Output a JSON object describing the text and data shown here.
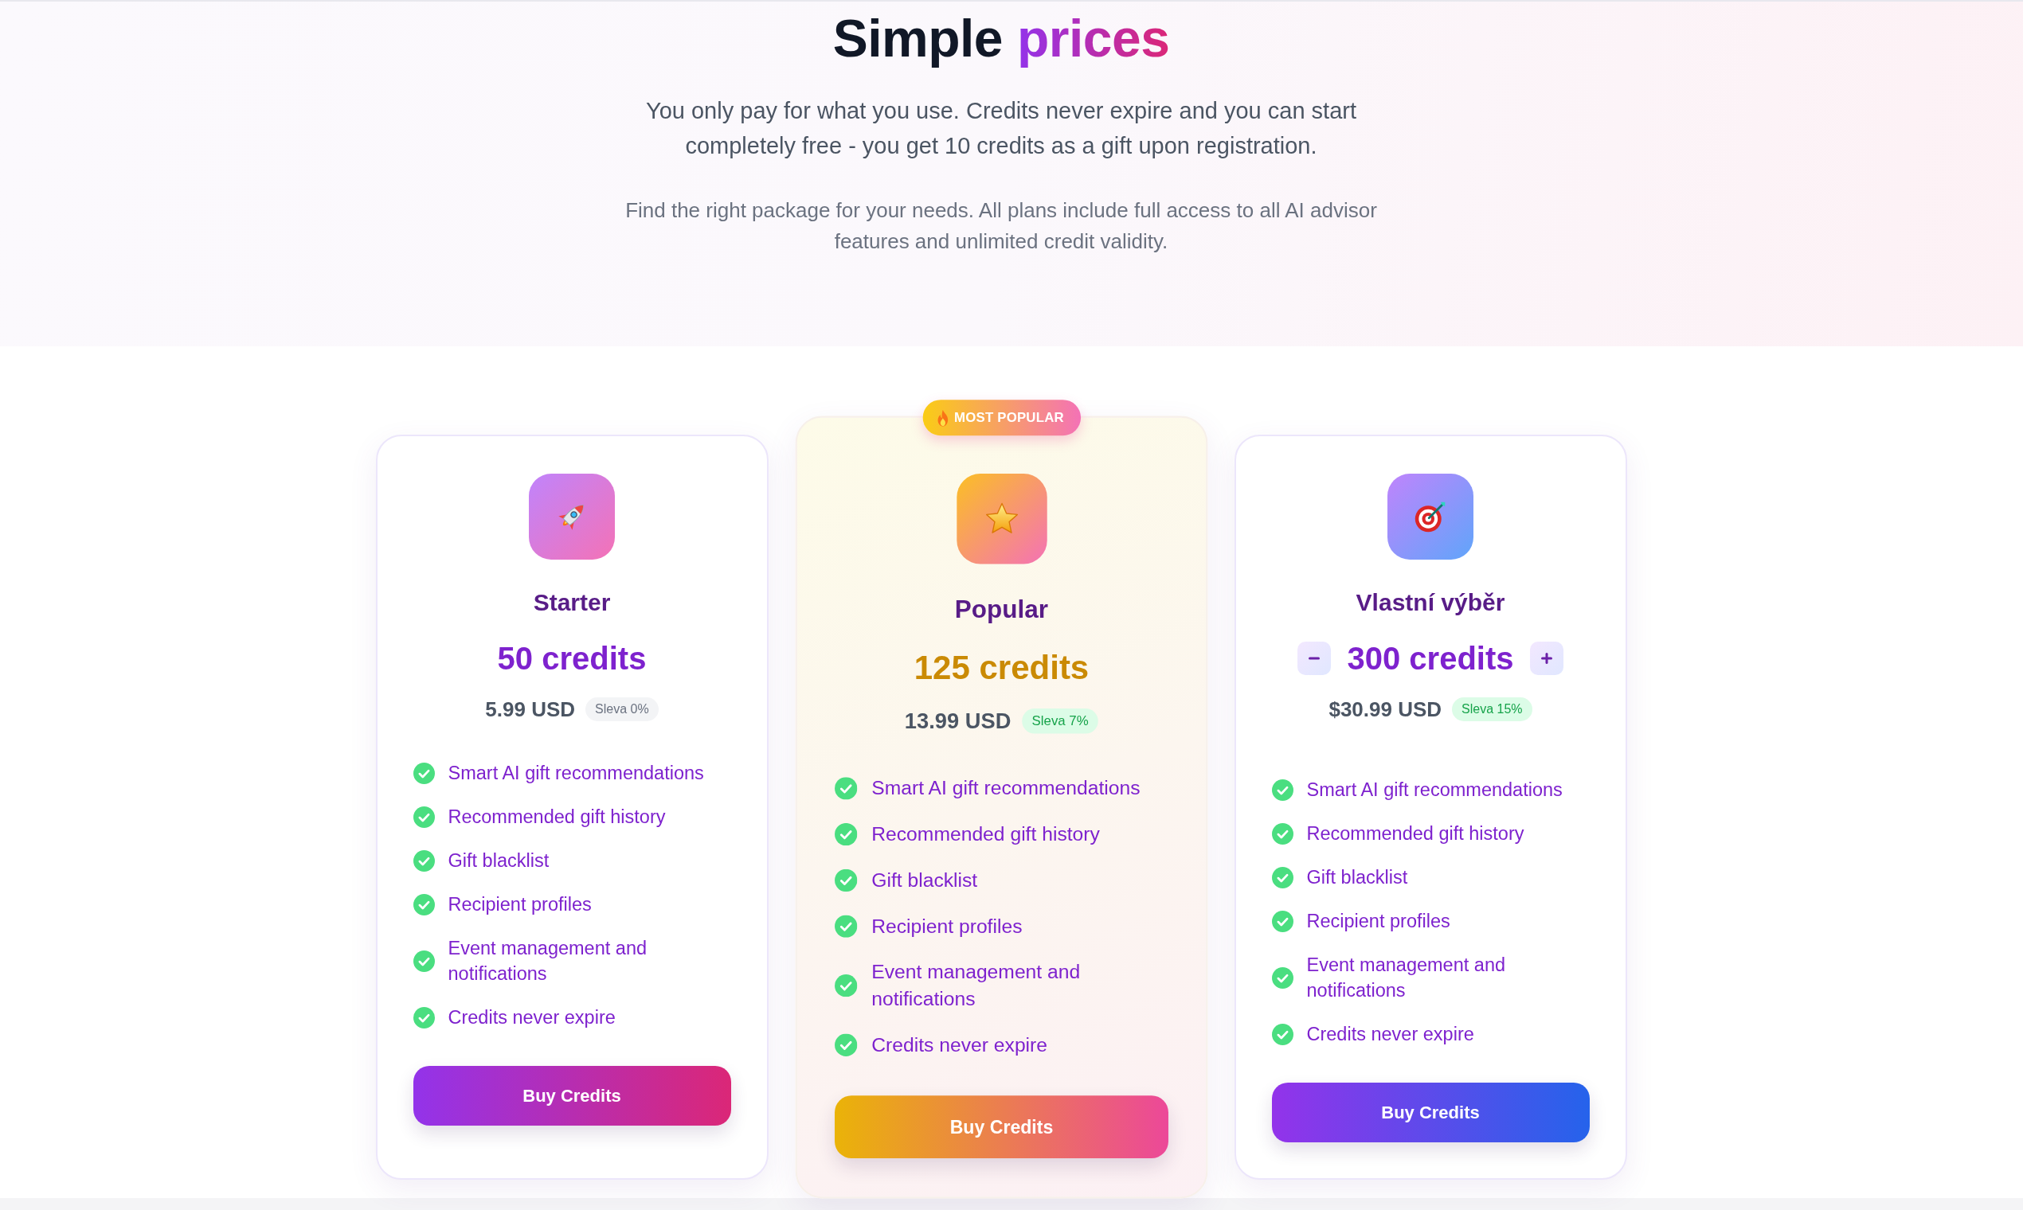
{
  "header": {
    "title": "Simple",
    "title_accent": "prices",
    "lead": "You only pay for what you use. Credits never expire and you can start completely free - you get 10 credits as a gift upon registration.",
    "description": "Find the right package for your needs. All plans include full access to all AI advisor features and unlimited credit validity."
  },
  "plans": [
    {
      "kind": "starter",
      "name": "Starter",
      "credits": "50 credits",
      "price": "5.99 USD",
      "discount": {
        "label": "Sleva 0%",
        "active": false
      },
      "features": [
        "Smart AI gift recommendations",
        "Recommended gift history",
        "Gift blacklist",
        "Recipient profiles",
        "Event management and notifications",
        "Credits never expire"
      ],
      "button": "Buy Credits"
    },
    {
      "kind": "popular",
      "badge": "MOST POPULAR",
      "name": "Popular",
      "credits": "125 credits",
      "price": "13.99 USD",
      "discount": {
        "label": "Sleva 7%",
        "active": true
      },
      "features": [
        "Smart AI gift recommendations",
        "Recommended gift history",
        "Gift blacklist",
        "Recipient profiles",
        "Event management and notifications",
        "Credits never expire"
      ],
      "button": "Buy Credits"
    },
    {
      "kind": "custom",
      "name": "Vlastní výběr",
      "credits": "300 credits",
      "price": "$30.99 USD",
      "discount": {
        "label": "Sleva 15%",
        "active": true
      },
      "features": [
        "Smart AI gift recommendations",
        "Recommended gift history",
        "Gift blacklist",
        "Recipient profiles",
        "Event management and notifications",
        "Credits never expire"
      ],
      "button": "Buy Credits"
    }
  ]
}
